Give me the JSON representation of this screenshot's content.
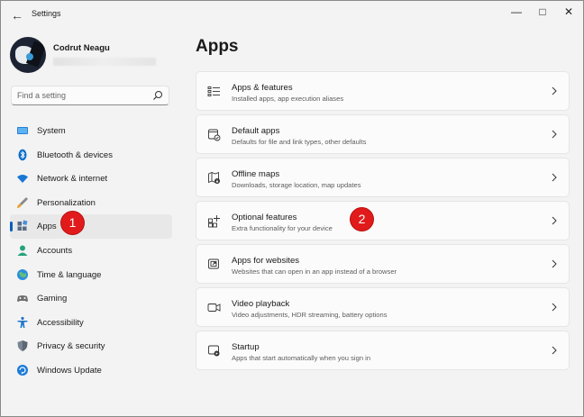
{
  "window": {
    "title": "Settings"
  },
  "controls": {
    "minimize": "—",
    "maximize": "□",
    "close": "✕"
  },
  "profile": {
    "name": "Codrut Neagu"
  },
  "search": {
    "placeholder": "Find a setting"
  },
  "sidebar": {
    "items": [
      {
        "label": "System",
        "icon": "system-icon"
      },
      {
        "label": "Bluetooth & devices",
        "icon": "bluetooth-icon"
      },
      {
        "label": "Network & internet",
        "icon": "wifi-icon"
      },
      {
        "label": "Personalization",
        "icon": "brush-icon"
      },
      {
        "label": "Apps",
        "icon": "apps-icon",
        "active": true
      },
      {
        "label": "Accounts",
        "icon": "person-icon"
      },
      {
        "label": "Time & language",
        "icon": "globe-clock-icon"
      },
      {
        "label": "Gaming",
        "icon": "gamepad-icon"
      },
      {
        "label": "Accessibility",
        "icon": "accessibility-icon"
      },
      {
        "label": "Privacy & security",
        "icon": "shield-icon"
      },
      {
        "label": "Windows Update",
        "icon": "update-icon"
      }
    ]
  },
  "main": {
    "title": "Apps",
    "cards": [
      {
        "title": "Apps & features",
        "description": "Installed apps, app execution aliases",
        "icon": "list-icon"
      },
      {
        "title": "Default apps",
        "description": "Defaults for file and link types, other defaults",
        "icon": "default-apps-icon"
      },
      {
        "title": "Offline maps",
        "description": "Downloads, storage location, map updates",
        "icon": "map-icon"
      },
      {
        "title": "Optional features",
        "description": "Extra functionality for your device",
        "icon": "optional-features-icon"
      },
      {
        "title": "Apps for websites",
        "description": "Websites that can open in an app instead of a browser",
        "icon": "web-apps-icon"
      },
      {
        "title": "Video playback",
        "description": "Video adjustments, HDR streaming, battery options",
        "icon": "video-icon"
      },
      {
        "title": "Startup",
        "description": "Apps that start automatically when you sign in",
        "icon": "startup-icon"
      }
    ]
  },
  "annotations": {
    "badge1": "1",
    "badge2": "2"
  },
  "colors": {
    "accent": "#005fb8",
    "badge": "#e11b1b",
    "sidebar_bg": "#f3f3f3",
    "card_bg": "#fbfbfb"
  }
}
